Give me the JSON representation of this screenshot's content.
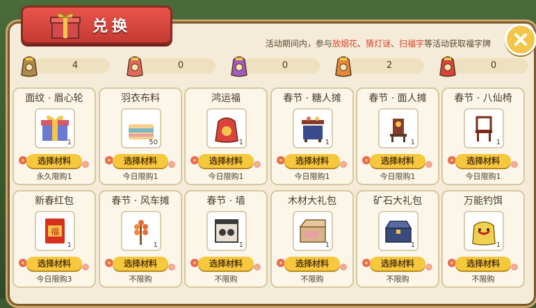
{
  "title": "兑换",
  "notice": {
    "prefix": "活动期间内，参与",
    "h1": "放烟花",
    "sep1": "、",
    "h2": "猜灯谜",
    "sep2": "、",
    "h3": "扫福字",
    "suffix": "等活动获取福字牌"
  },
  "counters": [
    {
      "color": "#b08a4a",
      "value": "4"
    },
    {
      "color": "#e26a5a",
      "value": "0"
    },
    {
      "color": "#a05ac0",
      "value": "0"
    },
    {
      "color": "#e68a3a",
      "value": "2"
    },
    {
      "color": "#d8433a",
      "value": "0"
    }
  ],
  "select_label": "选择材料",
  "items": [
    {
      "name": "面纹 · 眉心轮",
      "icon": "gift-box-icon",
      "qty": "1",
      "limit": "永久限购1"
    },
    {
      "name": "羽衣布料",
      "icon": "fabric-icon",
      "qty": "50",
      "limit": "今日限购1"
    },
    {
      "name": "鸿运福",
      "icon": "red-pouch-icon",
      "qty": "1",
      "limit": "今日限购1"
    },
    {
      "name": "春节 · 糖人摊",
      "icon": "candy-stall-icon",
      "qty": "1",
      "limit": "今日限购1"
    },
    {
      "name": "春节 · 面人摊",
      "icon": "dough-stall-icon",
      "qty": "1",
      "limit": "今日限购1"
    },
    {
      "name": "春节 · 八仙椅",
      "icon": "chair-icon",
      "qty": "1",
      "limit": "今日限购1"
    },
    {
      "name": "新春红包",
      "icon": "red-envelope-icon",
      "qty": "1",
      "limit": "今日限购3"
    },
    {
      "name": "春节 · 风车摊",
      "icon": "pinwheel-stall-icon",
      "qty": "1",
      "limit": "不限购"
    },
    {
      "name": "春节 · 墙",
      "icon": "wall-icon",
      "qty": "1",
      "limit": "不限购"
    },
    {
      "name": "木材大礼包",
      "icon": "wood-chest-icon",
      "qty": "1",
      "limit": "不限购"
    },
    {
      "name": "矿石大礼包",
      "icon": "ore-chest-icon",
      "qty": "1",
      "limit": "不限购"
    },
    {
      "name": "万能钓饵",
      "icon": "bait-bag-icon",
      "qty": "1",
      "limit": "不限购"
    }
  ],
  "envelope_text": "福"
}
